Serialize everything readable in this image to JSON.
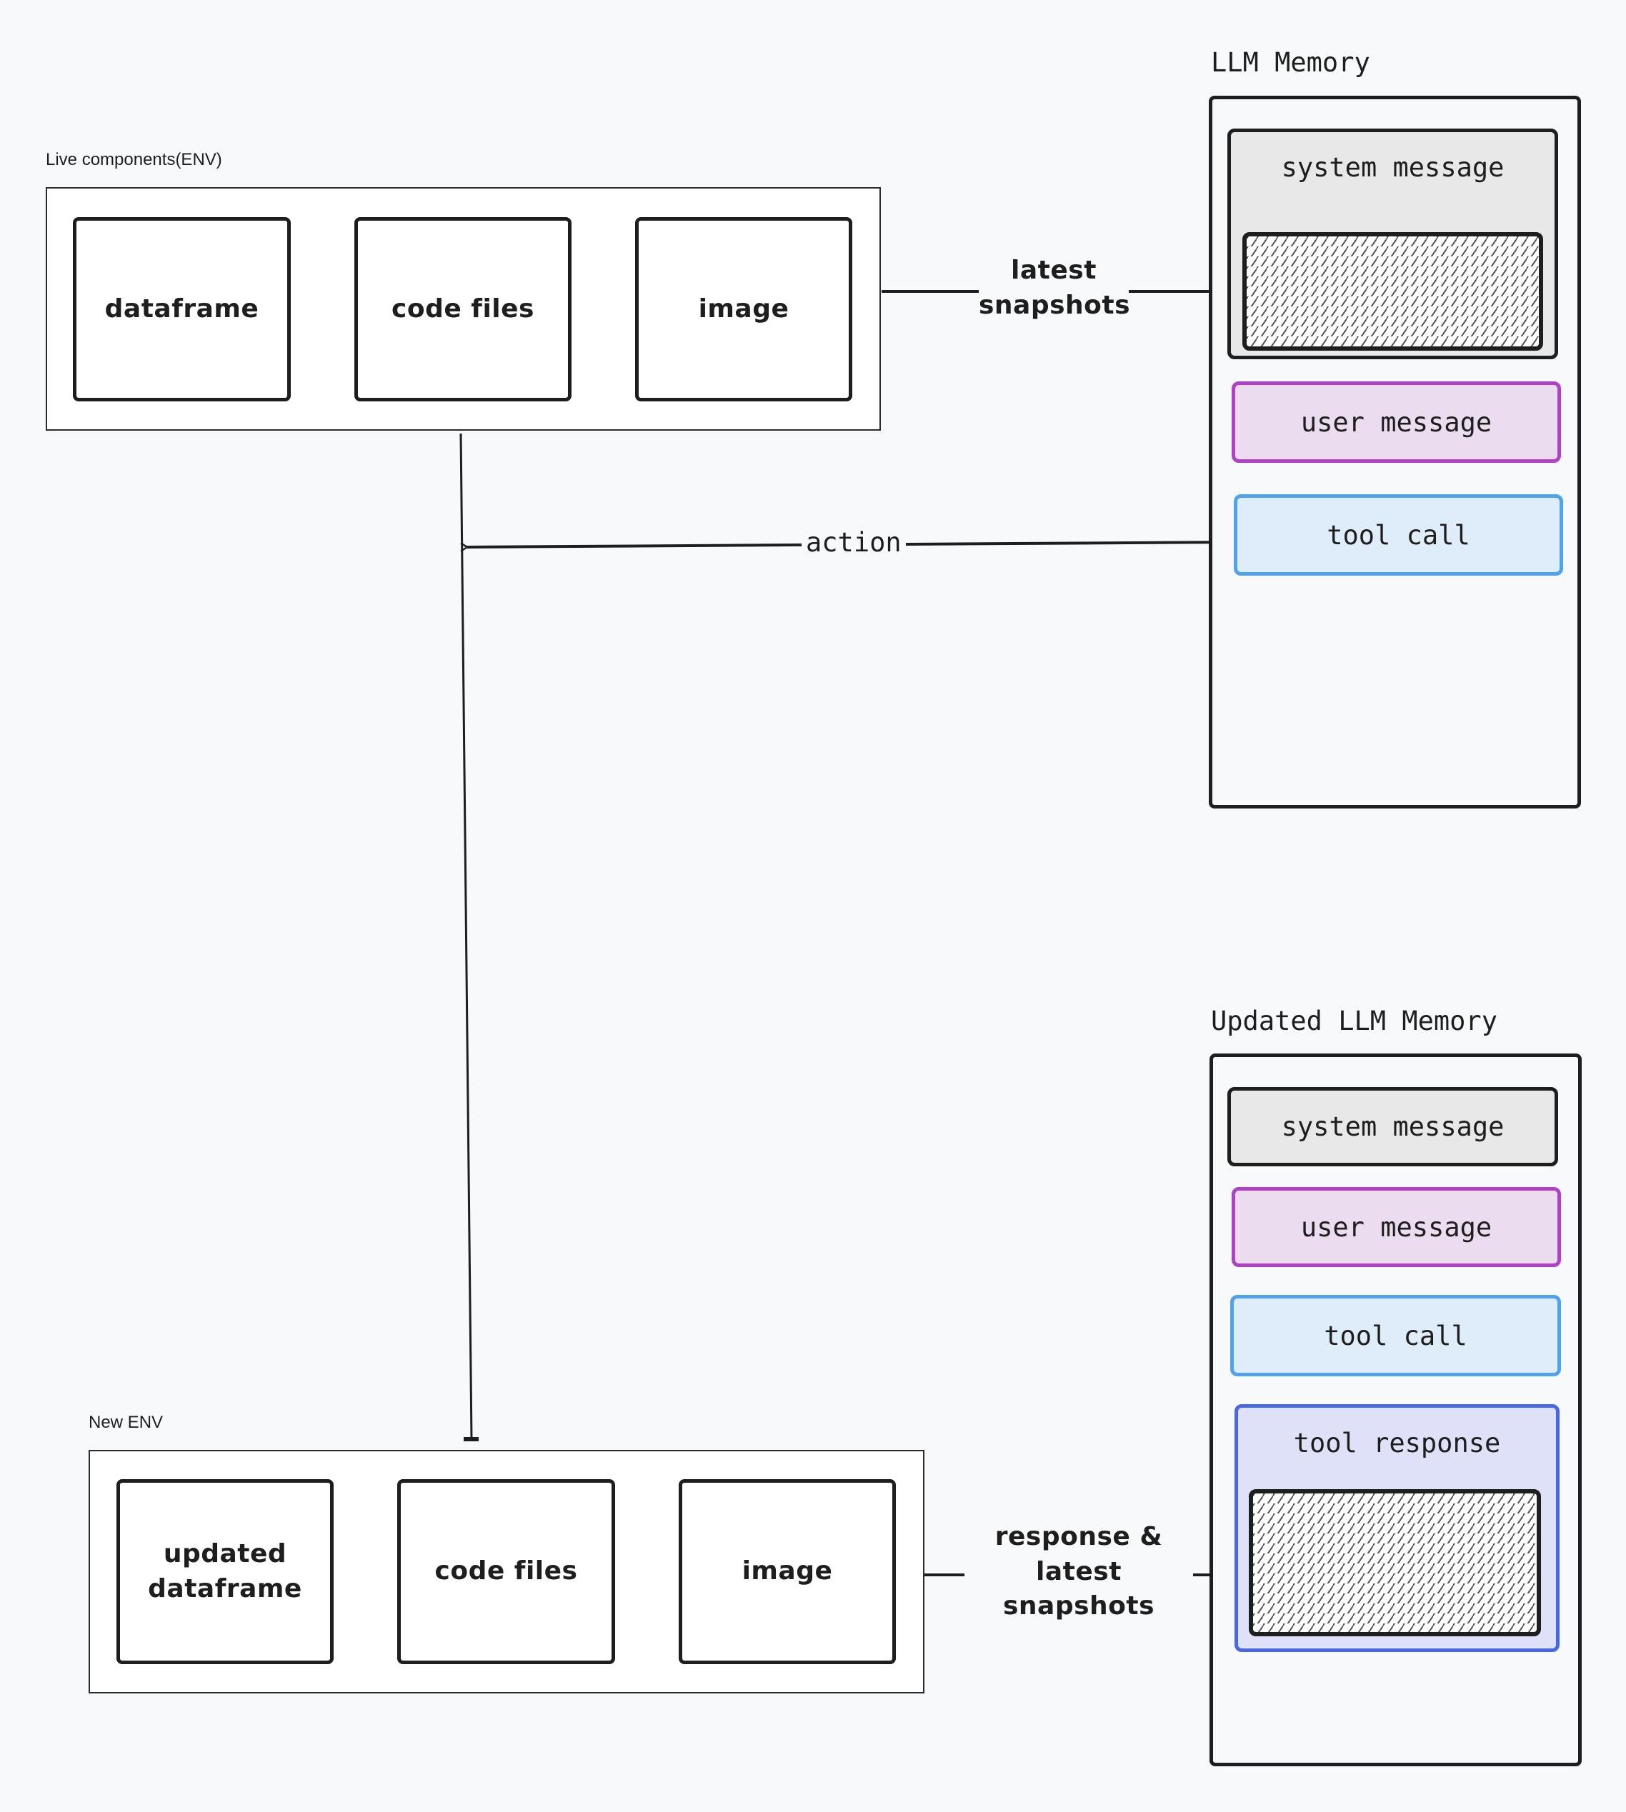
{
  "live_env": {
    "label": "Live components(ENV)",
    "components": [
      "dataframe",
      "code files",
      "image"
    ]
  },
  "llm_memory": {
    "title": "LLM Memory",
    "messages": {
      "system": "system message",
      "user": "user message",
      "tool_call": "tool call"
    }
  },
  "edges": {
    "latest_snapshots": "latest\nsnapshots",
    "action": "action",
    "response_snapshots": "response &\nlatest\nsnapshots"
  },
  "new_env": {
    "label": "New ENV",
    "components": [
      "updated\ndataframe",
      "code files",
      "image"
    ]
  },
  "updated_memory": {
    "title": "Updated LLM Memory",
    "messages": {
      "system": "system message",
      "user": "user message",
      "tool_call": "tool call",
      "tool_response": "tool response"
    }
  },
  "colors": {
    "background": "#f8f9fb",
    "stroke": "#1e1e1e",
    "system_fill": "#e8e8e8",
    "user_fill": "#ecdcf0",
    "user_stroke": "#b040c8",
    "tool_call_fill": "#dfecf9",
    "tool_call_stroke": "#4ea2ee",
    "tool_response_fill": "#dee1f7",
    "tool_response_stroke": "#4867e6"
  }
}
